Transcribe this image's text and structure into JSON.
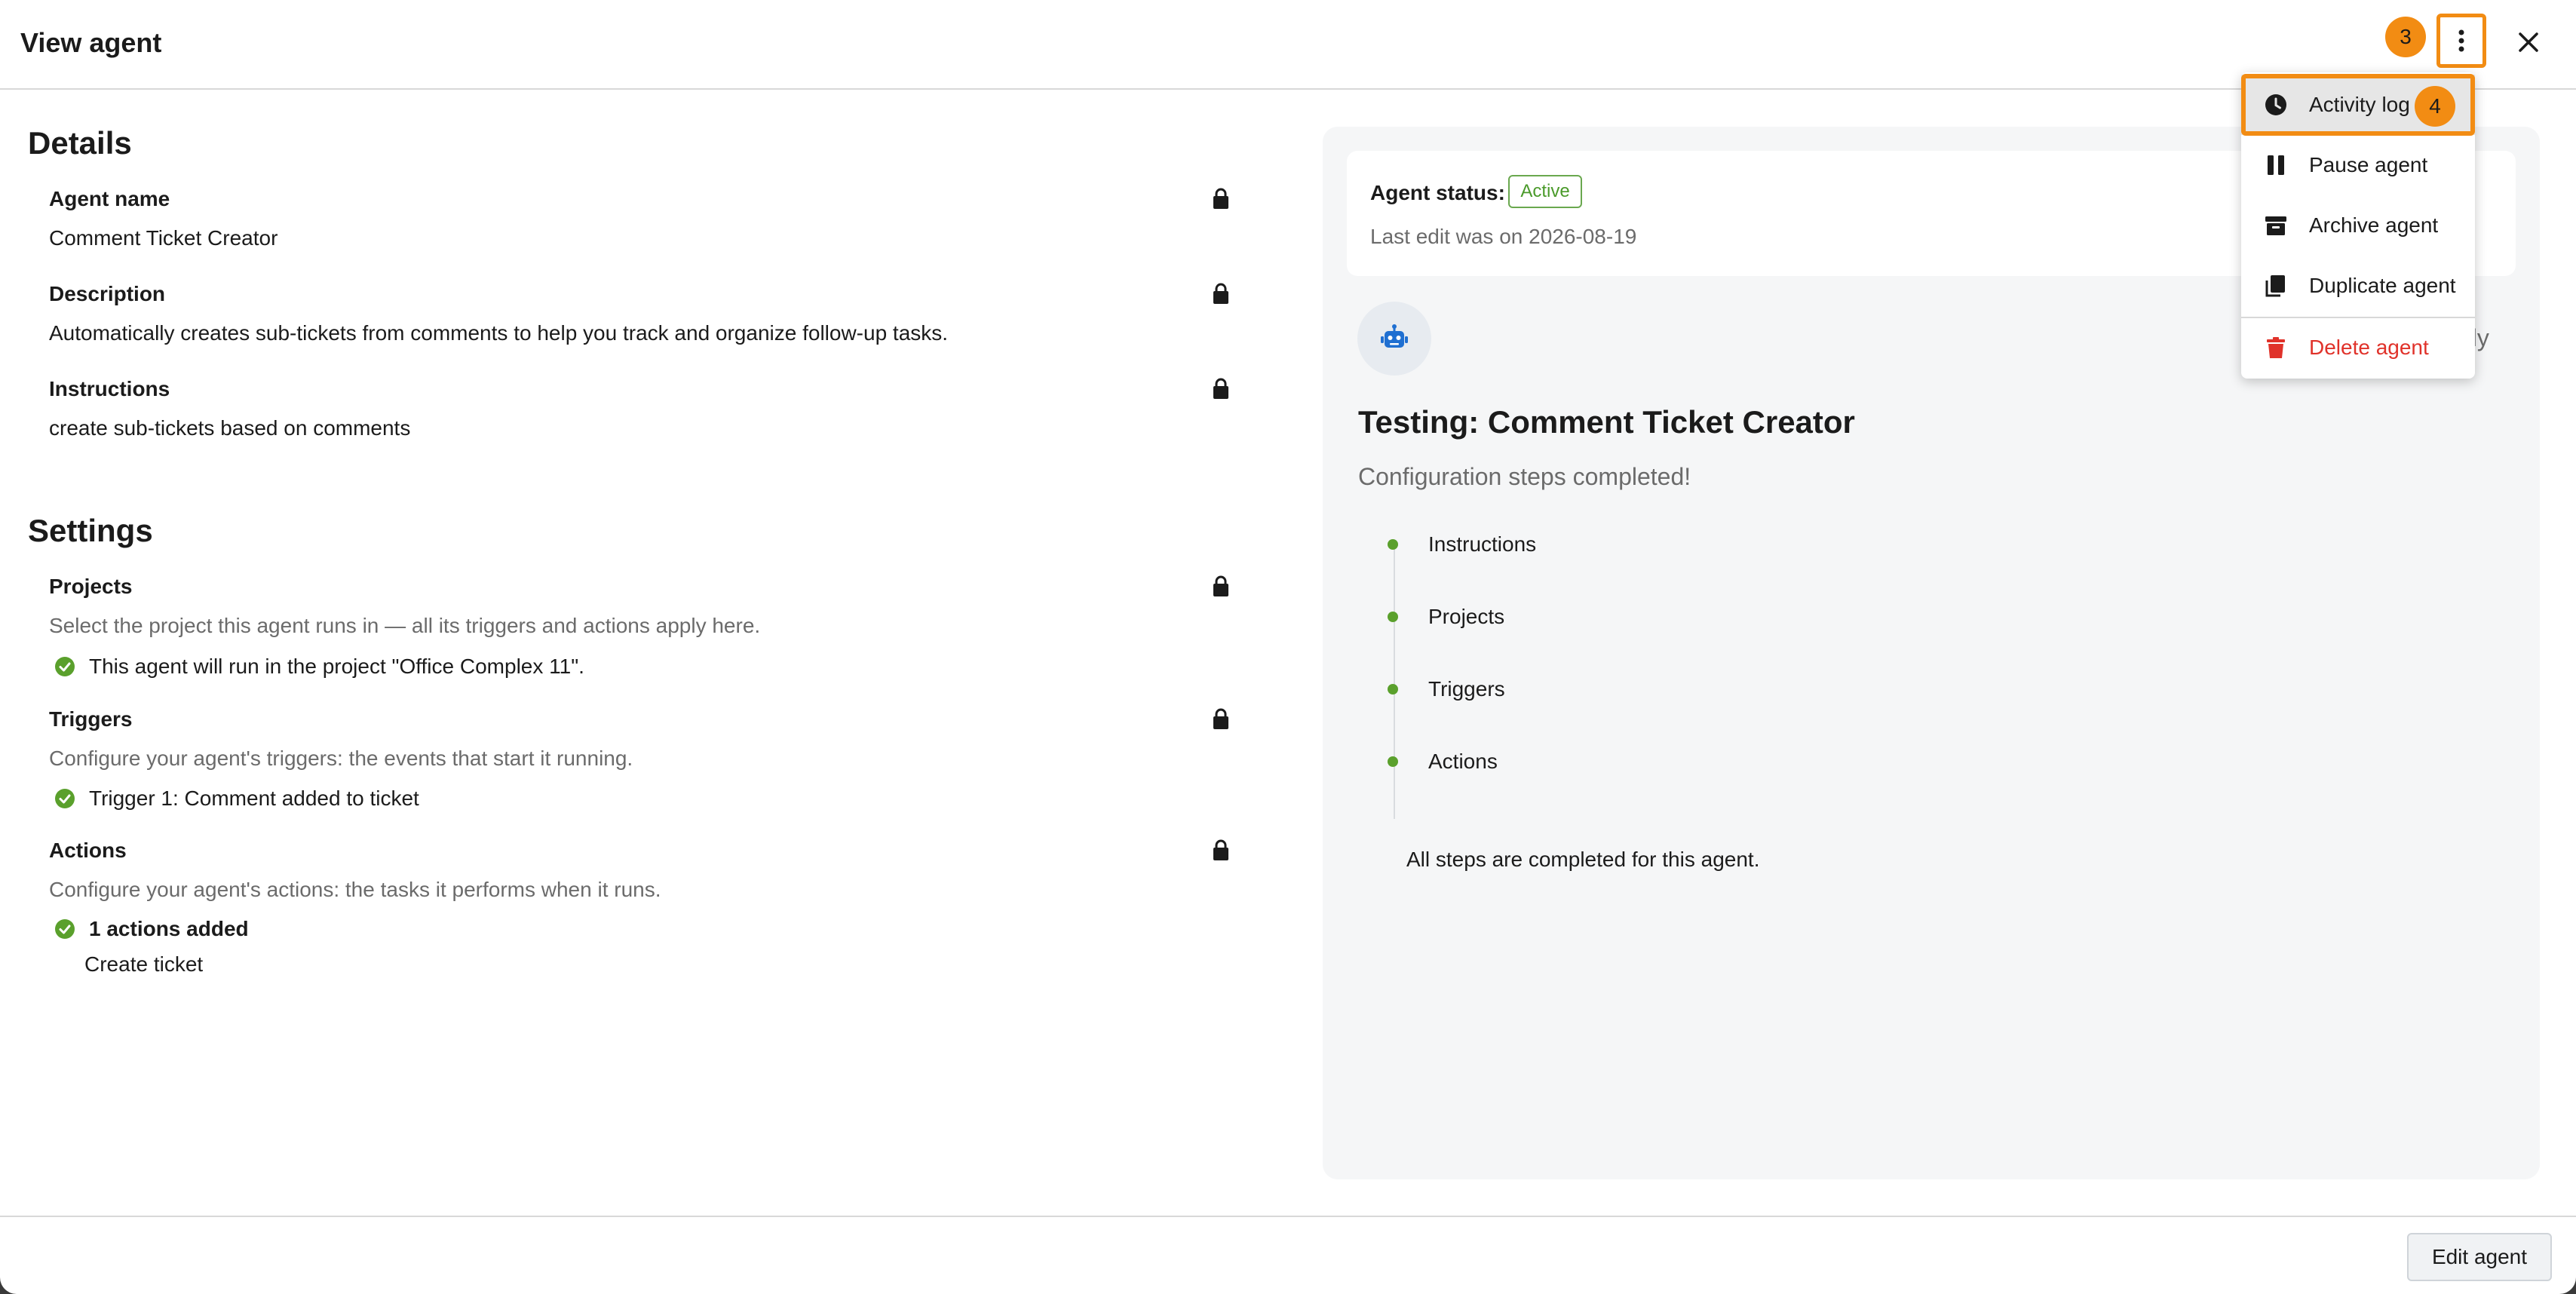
{
  "header": {
    "title": "View agent"
  },
  "annotations": {
    "kebab_badge": "3",
    "menu_badge": "4"
  },
  "details": {
    "heading": "Details",
    "agent_name_label": "Agent name",
    "agent_name_value": "Comment Ticket Creator",
    "description_label": "Description",
    "description_value": "Automatically creates sub-tickets from comments to help you track and organize follow-up tasks.",
    "instructions_label": "Instructions",
    "instructions_value": "create sub-tickets based on comments"
  },
  "settings": {
    "heading": "Settings",
    "projects_label": "Projects",
    "projects_help": "Select the project this agent runs in — all its triggers and actions apply here.",
    "projects_value": "This agent will run in the project \"Office Complex 11\".",
    "triggers_label": "Triggers",
    "triggers_help": "Configure your agent's triggers: the events that start it running.",
    "triggers_value": "Trigger 1: Comment added to ticket",
    "actions_label": "Actions",
    "actions_help": "Configure your agent's actions: the tasks it performs when it runs.",
    "actions_count": "1 actions added",
    "actions_item": "Create ticket"
  },
  "status": {
    "label": "Agent status:",
    "pill": "Active",
    "last_edit": "Last edit was on 2026-08-19"
  },
  "testing": {
    "partial_text": "nly",
    "title": "Testing: Comment Ticket Creator",
    "subtitle": "Configuration steps completed!",
    "steps": [
      "Instructions",
      "Projects",
      "Triggers",
      "Actions"
    ],
    "all_done": "All steps are completed for this agent."
  },
  "menu": {
    "items": [
      {
        "label": "Activity log",
        "icon": "clock-icon"
      },
      {
        "label": "Pause agent",
        "icon": "pause-icon"
      },
      {
        "label": "Archive agent",
        "icon": "archive-icon"
      },
      {
        "label": "Duplicate agent",
        "icon": "copy-icon"
      },
      {
        "label": "Delete agent",
        "icon": "trash-icon"
      }
    ]
  },
  "footer": {
    "edit_button": "Edit agent"
  },
  "colors": {
    "accent": "#f28c13",
    "success": "#5aa02c",
    "danger": "#e0322a",
    "robot": "#1f6fd1"
  }
}
